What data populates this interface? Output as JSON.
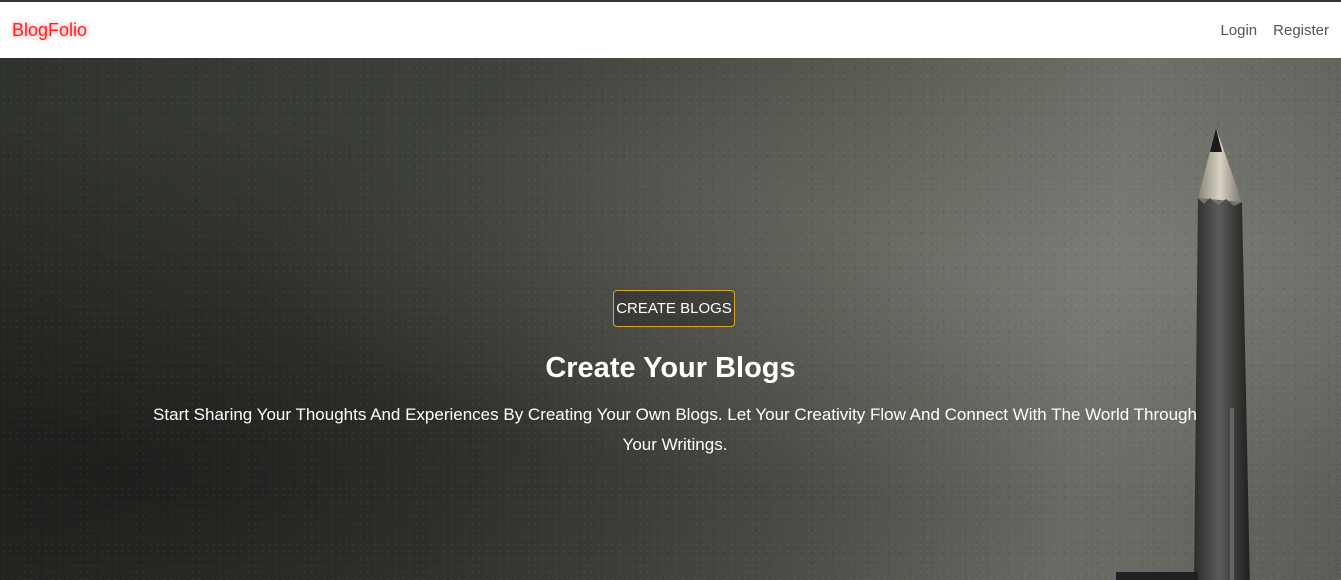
{
  "navbar": {
    "brand": "BlogFolio",
    "links": [
      {
        "label": "Login"
      },
      {
        "label": "Register"
      }
    ]
  },
  "hero": {
    "button_label": "CREATE BLOGS",
    "title": "Create Your Blogs",
    "subtitle": "Start Sharing Your Thoughts And Experiences By Creating Your Own Blogs. Let Your Creativity Flow And Connect With The World Through Your Writings."
  },
  "colors": {
    "brand": "#ff1f1f",
    "button_border": "#d6a52a",
    "hero_text": "#ffffff"
  }
}
